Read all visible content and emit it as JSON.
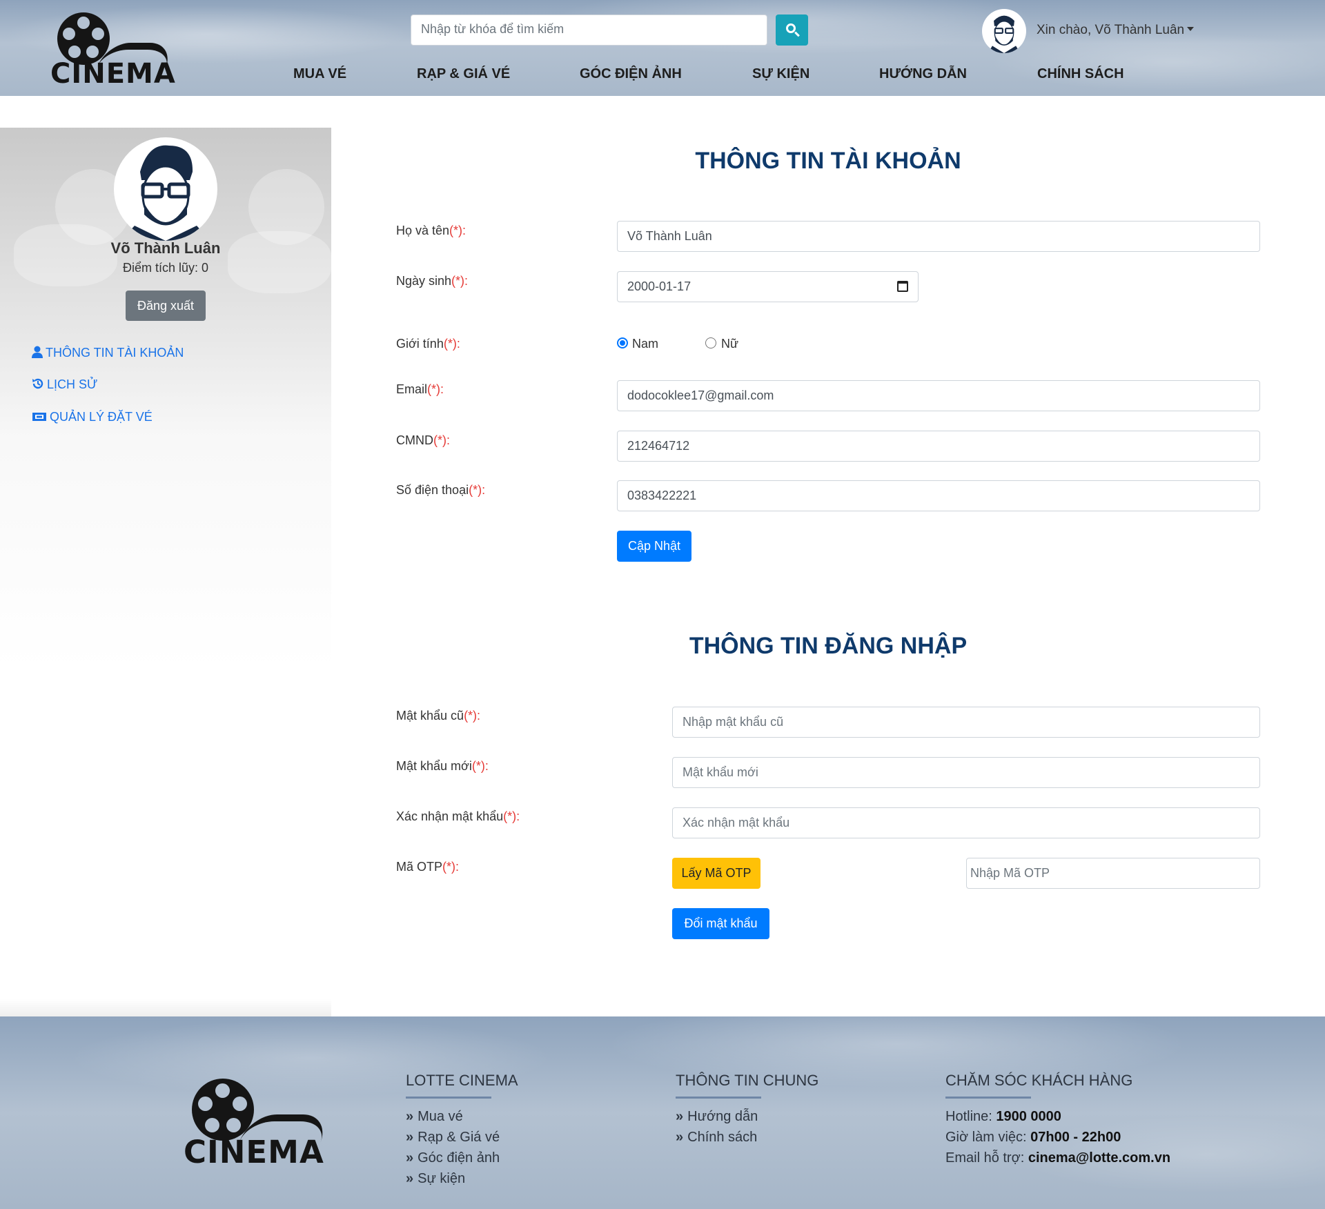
{
  "brand": {
    "logo_text": "CINEMA"
  },
  "header": {
    "search_placeholder": "Nhập từ khóa để tìm kiếm",
    "greeting": "Xin chào, Võ Thành Luân",
    "nav": [
      "MUA VÉ",
      "RẠP & GIÁ VÉ",
      "GÓC ĐIỆN ẢNH",
      "SỰ KIỆN",
      "HƯỚNG DẪN",
      "CHÍNH SÁCH"
    ]
  },
  "sidebar": {
    "name": "Võ Thành Luân",
    "points": "Điểm tích lũy: 0",
    "logout": "Đăng xuất",
    "links": [
      "THÔNG TIN TÀI KHOẢN",
      "LỊCH SỬ",
      "QUẢN LÝ ĐẶT VÉ"
    ]
  },
  "account": {
    "title": "THÔNG TIN TÀI KHOẢN",
    "required_mark": "(*):",
    "fullname_label": "Họ và tên",
    "fullname_value": "Võ Thành Luân",
    "dob_label": "Ngày sinh",
    "dob_value": "2000-01-17",
    "gender_label": "Giới tính",
    "gender_male": "Nam",
    "gender_female": "Nữ",
    "gender_selected": "Nam",
    "email_label": "Email",
    "email_value": "dodocoklee17@gmail.com",
    "cmnd_label": "CMND",
    "cmnd_value": "212464712",
    "phone_label": "Số điện thoại",
    "phone_value": "0383422221",
    "update_button": "Cập Nhật"
  },
  "login": {
    "title": "THÔNG TIN ĐĂNG NHẬP",
    "old_pw_label": "Mật khẩu cũ",
    "old_pw_placeholder": "Nhập mật khẩu cũ",
    "new_pw_label": "Mật khẩu mới",
    "new_pw_placeholder": "Mật khẩu mới",
    "confirm_pw_label": "Xác nhận mật khẩu",
    "confirm_pw_placeholder": "Xác nhận mật khẩu",
    "otp_label": "Mã OTP",
    "otp_button": "Lấy Mã OTP",
    "otp_placeholder": "Nhập Mã OTP",
    "change_pw_button": "Đổi mật khẩu"
  },
  "footer": {
    "col1_title": "LOTTE CINEMA",
    "col1_links": [
      "Mua vé",
      "Rạp & Giá vé",
      "Góc điện ảnh",
      "Sự kiện"
    ],
    "col2_title": "THÔNG TIN CHUNG",
    "col2_links": [
      "Hướng dẫn",
      "Chính sách"
    ],
    "col3_title": "CHĂM SÓC KHÁCH HÀNG",
    "hotline_label": "Hotline: ",
    "hotline_value": "1900 0000",
    "hours_label": "Giờ làm việc: ",
    "hours_value": "07h00 - 22h00",
    "email_label": "Email hỗ trợ: ",
    "email_value": "cinema@lotte.com.vn"
  },
  "colors": {
    "primary": "#007bff",
    "warning": "#ffc107",
    "info": "#17a2b8",
    "title": "#0f3a6b",
    "required": "#e53935"
  }
}
